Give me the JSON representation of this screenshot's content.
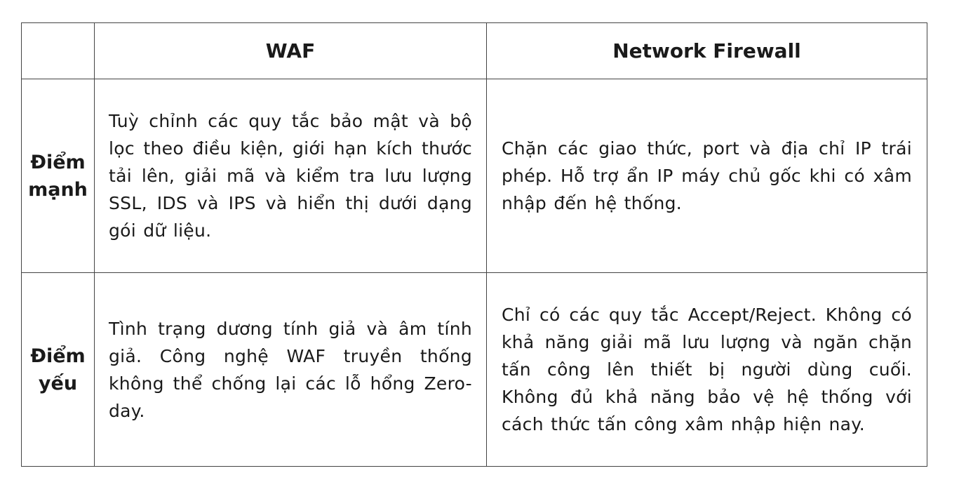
{
  "table": {
    "header": {
      "corner": "",
      "col_waf": "WAF",
      "col_network_firewall": "Network Firewall"
    },
    "rows": [
      {
        "label": "Điểm mạnh",
        "waf": "Tuỳ chỉnh các quy tắc bảo mật và bộ lọc theo điều kiện, giới hạn kích thước tải lên, giải mã và kiểm tra lưu lượng SSL, IDS và IPS và hiển thị dưới dạng gói dữ liệu.",
        "network_firewall": "Chặn các giao thức, port và địa chỉ IP trái phép. Hỗ trợ ẩn IP máy chủ gốc khi có xâm nhập đến hệ thống."
      },
      {
        "label": "Điểm yếu",
        "waf": "Tình trạng dương tính giả và âm tính giả. Công nghệ WAF truyền thống không thể chống lại các lỗ hổng Zero-day.",
        "network_firewall": "Chỉ có các quy tắc Accept/Reject. Không có khả năng giải mã lưu lượng và ngăn chặn tấn công lên thiết bị người dùng cuối. Không đủ khả năng bảo vệ hệ thống với cách thức tấn công xâm nhập hiện nay."
      }
    ]
  }
}
